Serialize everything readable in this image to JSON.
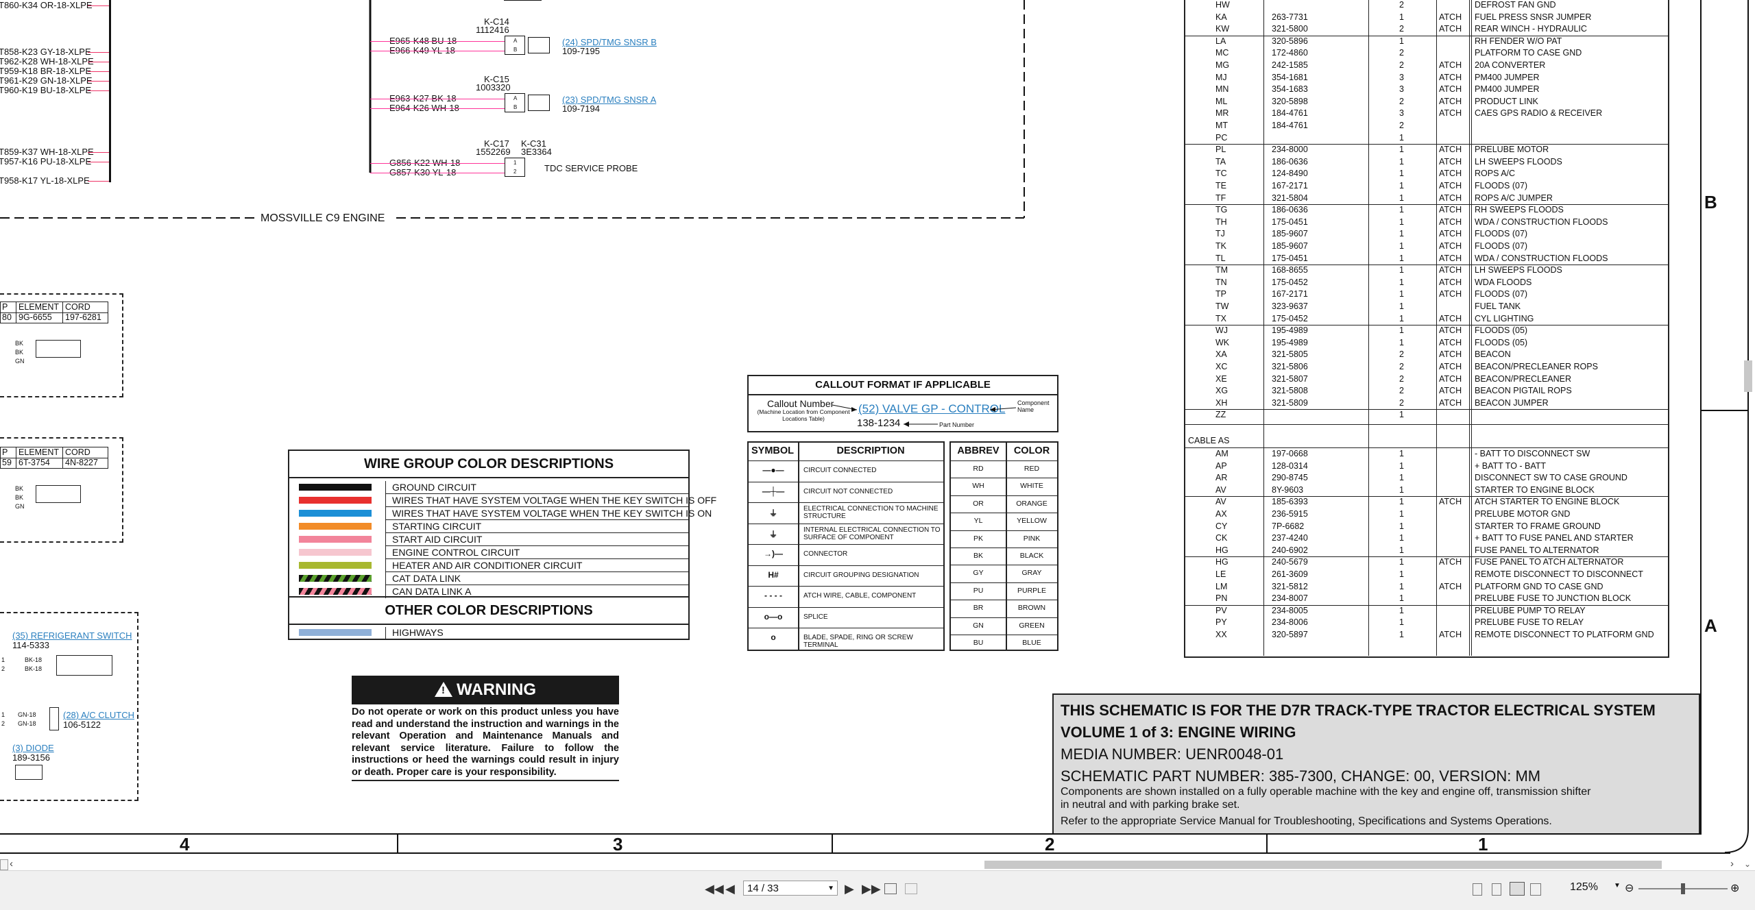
{
  "left_wires": [
    "T860-K34  OR-18-XLPE",
    "T858-K23  GY-18-XLPE",
    "T962-K28  WH-18-XLPE",
    "T959-K18  BR-18-XLPE",
    "T961-K29  GN-18-XLPE",
    "T960-K19  BU-18-XLPE",
    "T859-K37  WH-18-XLPE",
    "T957-K16  PU-18-XLPE",
    "T958-K17  YL-18-XLPE"
  ],
  "sensors": {
    "b": {
      "conn": "K-C14",
      "num": "1112416",
      "w1": "E965-K48  BU-18",
      "w2": "E966-K49  YL-18",
      "pins": [
        "A",
        "B"
      ],
      "link": "(24) SPD/TMG SNSR B",
      "part": "109-7195"
    },
    "a": {
      "conn": "K-C15",
      "num": "1003320",
      "w1": "E963-K27  BK-18",
      "w2": "E964-K26  WH-18",
      "pins": [
        "A",
        "B"
      ],
      "link": "(23) SPD/TMG SNSR A",
      "part": "109-7194"
    },
    "probe": {
      "conn": "K-C17",
      "num": "1552269",
      "conn2": "K-C31",
      "num2": "3E3364",
      "w1": "G856-K22  WH-18",
      "w2": "G857-K30  YL-18",
      "pins": [
        "1",
        "2"
      ],
      "label": "TDC SERVICE PROBE"
    }
  },
  "engine_label": "MOSSVILLE C9 ENGINE",
  "left_box1": {
    "h": [
      "P",
      "ELEMENT",
      "CORD"
    ],
    "v": [
      "80",
      "9G-6655",
      "197-6281"
    ],
    "w": [
      "BK",
      "BK",
      "GN"
    ]
  },
  "left_box2": {
    "h": [
      "P",
      "ELEMENT",
      "CORD"
    ],
    "v": [
      "59",
      "6T-3754",
      "4N-8227"
    ],
    "w": [
      "BK",
      "BK",
      "GN"
    ]
  },
  "left_box3": {
    "refrig": "(35) REFRIGERANT SWITCH",
    "refrig_part": "114-5333",
    "refrig_w": [
      "BK-18",
      "BK-18"
    ],
    "pins12": [
      "1",
      "2"
    ],
    "clutch": "(28) A/C CLUTCH",
    "clutch_part": "106-5122",
    "clutch_w": [
      "GN-18",
      "GN-18"
    ],
    "diode": "(3) DIODE",
    "diode_part": "189-3156"
  },
  "wire_group": {
    "title": "WIRE GROUP COLOR DESCRIPTIONS",
    "items": [
      "GROUND CIRCUIT",
      "WIRES THAT HAVE SYSTEM VOLTAGE WHEN THE KEY SWITCH IS OFF",
      "WIRES THAT HAVE SYSTEM VOLTAGE WHEN THE KEY SWITCH IS ON",
      "STARTING CIRCUIT",
      "START AID CIRCUIT",
      "ENGINE CONTROL CIRCUIT",
      "HEATER AND AIR CONDITIONER CIRCUIT",
      "CAT DATA LINK",
      "CAN DATA LINK A"
    ],
    "colors": [
      "#111111",
      "#e8312f",
      "#1c8fd6",
      "#f28c28",
      "#f2849a",
      "#f6c6cf",
      "#a8b830"
    ],
    "other_title": "OTHER COLOR DESCRIPTIONS",
    "other": [
      "HIGHWAYS"
    ],
    "other_color": "#8fb0d8"
  },
  "warning": {
    "title": "WARNING",
    "text": "Do not operate or work on this product unless you have read and understand the instruction and warnings in the relevant Operation and Maintenance Manuals and relevant service literature. Failure to follow the instructions or heed the warnings could result in injury or death. Proper care is your responsibility."
  },
  "callout": {
    "title": "CALLOUT FORMAT IF APPLICABLE",
    "callout_number": "Callout Number",
    "callout_sub": "(Machine Location from Component Locations Table)",
    "link": "(52) VALVE GP - CONTROL",
    "part": "138-1234",
    "component_name": "Component Name",
    "part_number": "Part Number"
  },
  "symbols": {
    "h1": "SYMBOL",
    "h2": "DESCRIPTION",
    "rows": [
      {
        "sym": "circuit-connected",
        "d": "CIRCUIT CONNECTED"
      },
      {
        "sym": "circuit-not-connected",
        "d": "CIRCUIT NOT CONNECTED"
      },
      {
        "sym": "machine-ground",
        "d": "ELECTRICAL CONNECTION TO MACHINE STRUCTURE"
      },
      {
        "sym": "internal-ground",
        "d": "INTERNAL ELECTRICAL CONNECTION TO SURFACE OF COMPONENT"
      },
      {
        "sym": "connector",
        "d": "CONNECTOR"
      },
      {
        "sym": "H#",
        "d": "CIRCUIT GROUPING DESIGNATION"
      },
      {
        "sym": "dashed",
        "d": "ATCH WIRE, CABLE, COMPONENT"
      },
      {
        "sym": "splice",
        "d": "SPLICE"
      },
      {
        "sym": "terminal",
        "d": "BLADE, SPADE, RING OR SCREW TERMINAL"
      }
    ]
  },
  "abbrev": {
    "h1": "ABBREV",
    "h2": "COLOR",
    "rows": [
      [
        "RD",
        "RED"
      ],
      [
        "WH",
        "WHITE"
      ],
      [
        "OR",
        "ORANGE"
      ],
      [
        "YL",
        "YELLOW"
      ],
      [
        "PK",
        "PINK"
      ],
      [
        "BK",
        "BLACK"
      ],
      [
        "GY",
        "GRAY"
      ],
      [
        "PU",
        "PURPLE"
      ],
      [
        "BR",
        "BROWN"
      ],
      [
        "GN",
        "GREEN"
      ],
      [
        "BU",
        "BLUE"
      ]
    ]
  },
  "harness_rows": [
    [
      "HW",
      "",
      "2",
      "",
      "DEFROST FAN GND"
    ],
    [
      "KA",
      "263-7731",
      "1",
      "ATCH",
      "FUEL PRESS SNSR JUMPER"
    ],
    [
      "KW",
      "321-5800",
      "2",
      "ATCH",
      "REAR WINCH - HYDRAULIC"
    ],
    [
      "LA",
      "320-5896",
      "1",
      "",
      "RH FENDER W/O PAT"
    ],
    [
      "MC",
      "172-4860",
      "2",
      "",
      "PLATFORM TO CASE GND"
    ],
    [
      "MG",
      "242-1585",
      "2",
      "ATCH",
      "20A CONVERTER"
    ],
    [
      "MJ",
      "354-1681",
      "3",
      "ATCH",
      "PM400 JUMPER"
    ],
    [
      "MN",
      "354-1683",
      "3",
      "ATCH",
      "PM400 JUMPER"
    ],
    [
      "ML",
      "320-5898",
      "2",
      "ATCH",
      "PRODUCT LINK"
    ],
    [
      "MR",
      "184-4761",
      "3",
      "ATCH",
      "CAES GPS RADIO & RECEIVER"
    ],
    [
      "MT",
      "184-4761",
      "2",
      "",
      ""
    ],
    [
      "PC",
      "",
      "1",
      "",
      ""
    ],
    [
      "PL",
      "234-8000",
      "1",
      "ATCH",
      "PRELUBE MOTOR"
    ],
    [
      "TA",
      "186-0636",
      "1",
      "ATCH",
      "LH SWEEPS FLOODS"
    ],
    [
      "TC",
      "124-8490",
      "1",
      "ATCH",
      "ROPS A/C"
    ],
    [
      "TE",
      "167-2171",
      "1",
      "ATCH",
      "FLOODS (07)"
    ],
    [
      "TF",
      "321-5804",
      "1",
      "ATCH",
      "ROPS A/C JUMPER"
    ],
    [
      "TG",
      "186-0636",
      "1",
      "ATCH",
      "RH SWEEPS FLOODS"
    ],
    [
      "TH",
      "175-0451",
      "1",
      "ATCH",
      "WDA / CONSTRUCTION FLOODS"
    ],
    [
      "TJ",
      "185-9607",
      "1",
      "ATCH",
      "FLOODS (07)"
    ],
    [
      "TK",
      "185-9607",
      "1",
      "ATCH",
      "FLOODS (07)"
    ],
    [
      "TL",
      "175-0451",
      "1",
      "ATCH",
      "WDA / CONSTRUCTION FLOODS"
    ],
    [
      "TM",
      "168-8655",
      "1",
      "ATCH",
      "LH SWEEPS FLOODS"
    ],
    [
      "TN",
      "175-0452",
      "1",
      "ATCH",
      "WDA FLOODS"
    ],
    [
      "TP",
      "167-2171",
      "1",
      "ATCH",
      "FLOODS (07)"
    ],
    [
      "TW",
      "323-9637",
      "1",
      "",
      "FUEL TANK"
    ],
    [
      "TX",
      "175-0452",
      "1",
      "ATCH",
      "CYL LIGHTING"
    ],
    [
      "WJ",
      "195-4989",
      "1",
      "ATCH",
      "FLOODS (05)"
    ],
    [
      "WK",
      "195-4989",
      "1",
      "ATCH",
      "FLOODS (05)"
    ],
    [
      "XA",
      "321-5805",
      "2",
      "ATCH",
      "BEACON"
    ],
    [
      "XC",
      "321-5806",
      "2",
      "ATCH",
      "BEACON/PRECLEANER ROPS"
    ],
    [
      "XE",
      "321-5807",
      "2",
      "ATCH",
      "BEACON/PRECLEANER"
    ],
    [
      "XG",
      "321-5808",
      "2",
      "ATCH",
      "BEACON PIGTAIL ROPS"
    ],
    [
      "XH",
      "321-5809",
      "2",
      "ATCH",
      "BEACON JUMPER"
    ],
    [
      "ZZ",
      "",
      "1",
      "",
      ""
    ]
  ],
  "cable_header": "CABLE AS",
  "cable_rows": [
    [
      "AM",
      "197-0668",
      "1",
      "",
      "- BATT TO DISCONNECT SW"
    ],
    [
      "AP",
      "128-0314",
      "1",
      "",
      "+ BATT TO - BATT"
    ],
    [
      "AR",
      "290-8745",
      "1",
      "",
      "DISCONNECT SW TO CASE GROUND"
    ],
    [
      "AV",
      "8Y-9603",
      "1",
      "",
      "STARTER TO ENGINE BLOCK"
    ],
    [
      "AV",
      "185-6393",
      "1",
      "ATCH",
      "ATCH STARTER TO ENGINE BLOCK"
    ],
    [
      "AX",
      "236-5915",
      "1",
      "",
      "PRELUBE MOTOR GND"
    ],
    [
      "CY",
      "7P-6682",
      "1",
      "",
      "STARTER TO FRAME GROUND"
    ],
    [
      "CK",
      "237-4240",
      "1",
      "",
      "+ BATT TO FUSE PANEL AND STARTER"
    ],
    [
      "HG",
      "240-6902",
      "1",
      "",
      "FUSE PANEL TO ALTERNATOR"
    ],
    [
      "HG",
      "240-5679",
      "1",
      "ATCH",
      "FUSE PANEL TO ATCH ALTERNATOR"
    ],
    [
      "LE",
      "261-3609",
      "1",
      "",
      "REMOTE DISCONNECT TO DISCONNECT"
    ],
    [
      "LM",
      "321-5812",
      "1",
      "ATCH",
      "PLATFORM GND TO CASE GND"
    ],
    [
      "PN",
      "234-8007",
      "1",
      "",
      "PRELUBE FUSE TO JUNCTION BLOCK"
    ],
    [
      "PV",
      "234-8005",
      "1",
      "",
      "PRELUBE PUMP TO RELAY"
    ],
    [
      "PY",
      "234-8006",
      "1",
      "",
      "PRELUBE FUSE TO RELAY"
    ],
    [
      "XX",
      "320-5897",
      "1",
      "ATCH",
      "REMOTE DISCONNECT TO PLATFORM GND"
    ]
  ],
  "title_block": {
    "line1": "THIS SCHEMATIC IS FOR THE D7R TRACK-TYPE TRACTOR ELECTRICAL SYSTEM",
    "line2": "VOLUME 1 of 3: ENGINE WIRING",
    "line3": "MEDIA NUMBER: UENR0048-01",
    "line4": "SCHEMATIC PART NUMBER: 385-7300, CHANGE: 00, VERSION: MM",
    "line5": "Components are shown installed on a fully operable machine with the key and engine off, transmission shifter",
    "line6": "in neutral and with parking brake set.",
    "line7": "Refer to the appropriate Service Manual for Troubleshooting, Specifications and Systems Operations."
  },
  "zones": {
    "cols": [
      "4",
      "3",
      "2",
      "1"
    ],
    "rows": [
      "B",
      "A"
    ]
  },
  "viewer": {
    "page": "14 / 33",
    "zoom": "125%",
    "zoom_level_pct": 50
  }
}
